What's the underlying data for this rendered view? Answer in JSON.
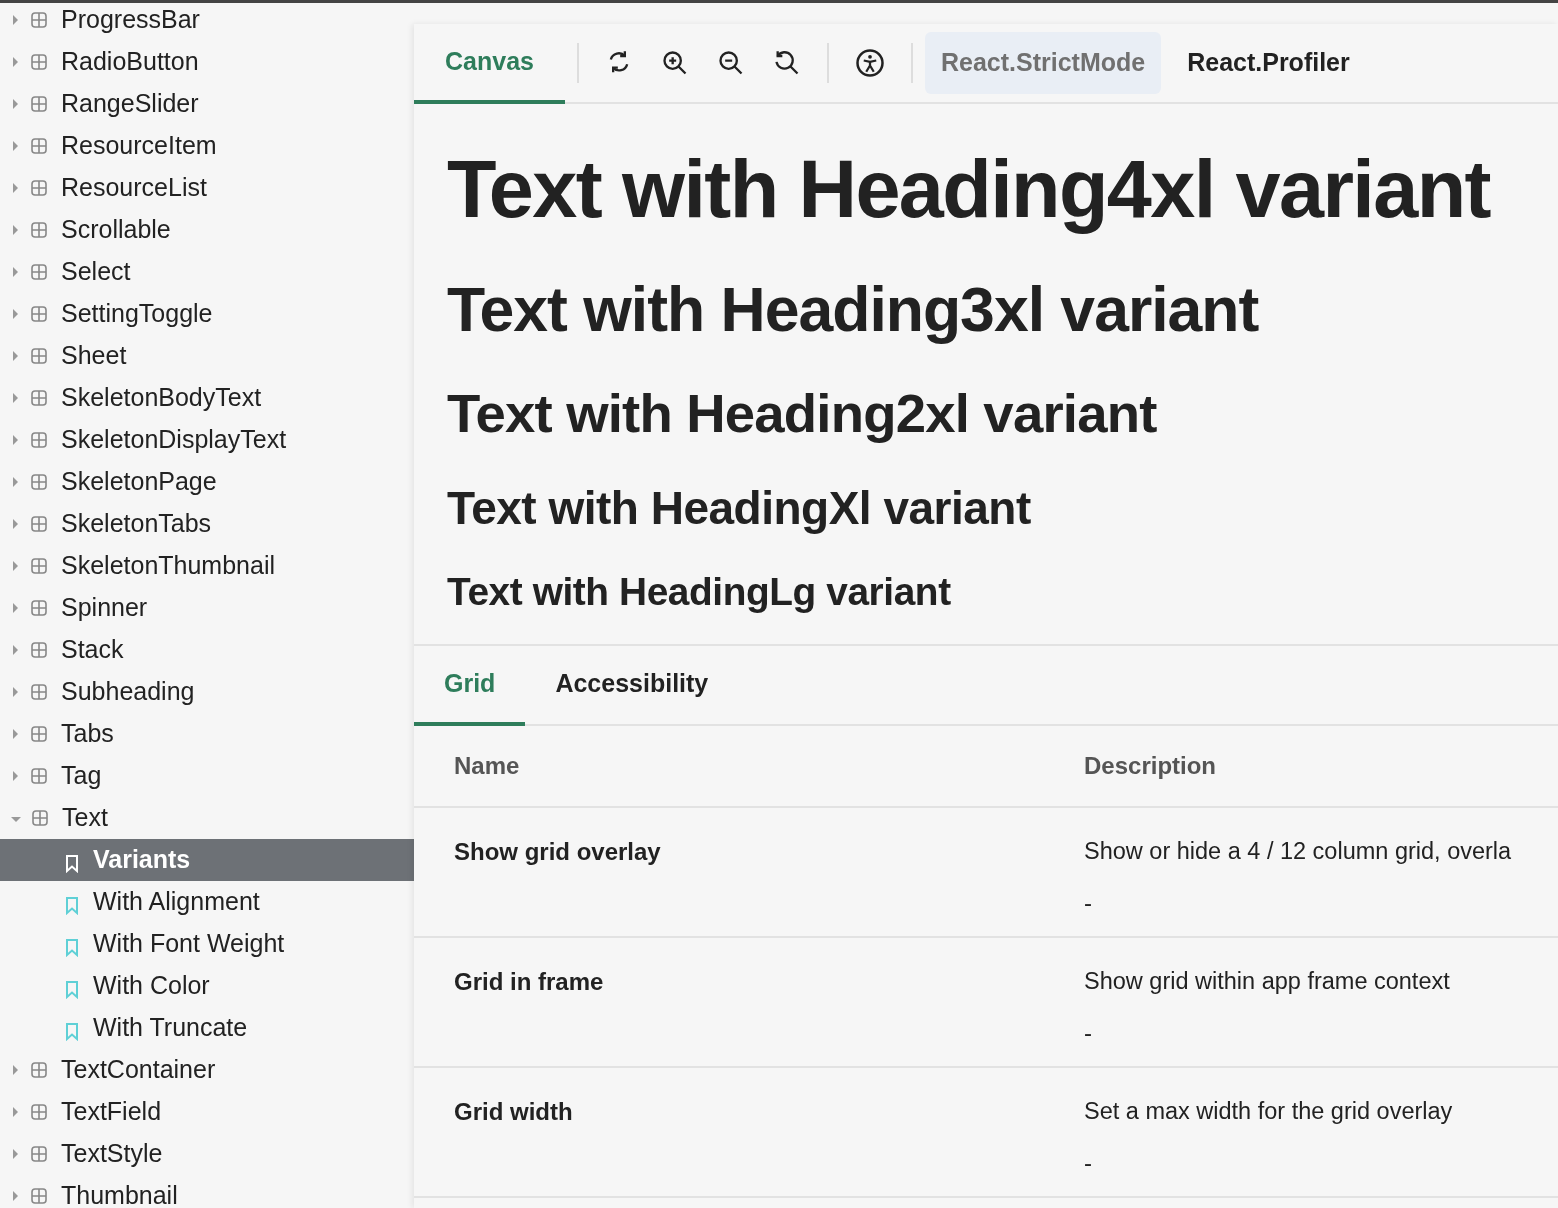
{
  "sidebar": {
    "items": [
      {
        "label": "ProgressBar",
        "kind": "component",
        "expanded": false
      },
      {
        "label": "RadioButton",
        "kind": "component",
        "expanded": false
      },
      {
        "label": "RangeSlider",
        "kind": "component",
        "expanded": false
      },
      {
        "label": "ResourceItem",
        "kind": "component",
        "expanded": false
      },
      {
        "label": "ResourceList",
        "kind": "component",
        "expanded": false
      },
      {
        "label": "Scrollable",
        "kind": "component",
        "expanded": false
      },
      {
        "label": "Select",
        "kind": "component",
        "expanded": false
      },
      {
        "label": "SettingToggle",
        "kind": "component",
        "expanded": false
      },
      {
        "label": "Sheet",
        "kind": "component",
        "expanded": false
      },
      {
        "label": "SkeletonBodyText",
        "kind": "component",
        "expanded": false
      },
      {
        "label": "SkeletonDisplayText",
        "kind": "component",
        "expanded": false
      },
      {
        "label": "SkeletonPage",
        "kind": "component",
        "expanded": false
      },
      {
        "label": "SkeletonTabs",
        "kind": "component",
        "expanded": false
      },
      {
        "label": "SkeletonThumbnail",
        "kind": "component",
        "expanded": false
      },
      {
        "label": "Spinner",
        "kind": "component",
        "expanded": false
      },
      {
        "label": "Stack",
        "kind": "component",
        "expanded": false
      },
      {
        "label": "Subheading",
        "kind": "component",
        "expanded": false
      },
      {
        "label": "Tabs",
        "kind": "component",
        "expanded": false
      },
      {
        "label": "Tag",
        "kind": "component",
        "expanded": false
      },
      {
        "label": "Text",
        "kind": "component",
        "expanded": true,
        "children": [
          {
            "label": "Variants",
            "kind": "story",
            "selected": true
          },
          {
            "label": "With Alignment",
            "kind": "story",
            "selected": false
          },
          {
            "label": "With Font Weight",
            "kind": "story",
            "selected": false
          },
          {
            "label": "With Color",
            "kind": "story",
            "selected": false
          },
          {
            "label": "With Truncate",
            "kind": "story",
            "selected": false
          }
        ]
      },
      {
        "label": "TextContainer",
        "kind": "component",
        "expanded": false
      },
      {
        "label": "TextField",
        "kind": "component",
        "expanded": false
      },
      {
        "label": "TextStyle",
        "kind": "component",
        "expanded": false
      },
      {
        "label": "Thumbnail",
        "kind": "component",
        "expanded": false
      }
    ]
  },
  "toolbar": {
    "tabs": [
      {
        "label": "Canvas",
        "selected": true
      }
    ],
    "addons": [
      {
        "label": "React.StrictMode",
        "on": true
      },
      {
        "label": "React.Profiler",
        "on": false
      }
    ]
  },
  "canvas": {
    "texts": [
      {
        "text": "Text with Heading4xl variant"
      },
      {
        "text": "Text with Heading3xl variant"
      },
      {
        "text": "Text with Heading2xl variant"
      },
      {
        "text": "Text with HeadingXl variant"
      },
      {
        "text": "Text with HeadingLg variant"
      }
    ]
  },
  "panel": {
    "tabs": [
      {
        "label": "Grid",
        "selected": true
      },
      {
        "label": "Accessibility",
        "selected": false
      }
    ],
    "table": {
      "columns": [
        "Name",
        "Description"
      ],
      "rows": [
        {
          "name": "Show grid overlay",
          "description": "Show or hide a 4 / 12 column grid, overla",
          "default": "-"
        },
        {
          "name": "Grid in frame",
          "description": "Show grid within app frame context",
          "default": "-"
        },
        {
          "name": "Grid width",
          "description": "Set a max width for the grid overlay",
          "default": "-"
        }
      ]
    }
  }
}
